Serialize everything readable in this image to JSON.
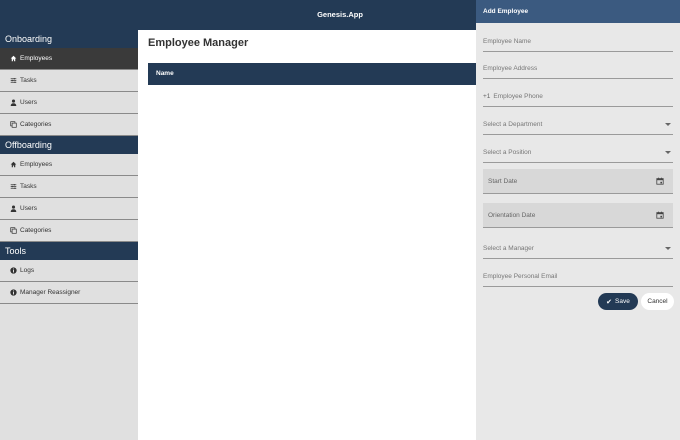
{
  "app": {
    "title": "Genesis.App"
  },
  "sidebar": {
    "sections": [
      {
        "title": "Onboarding",
        "items": [
          {
            "label": "Employees",
            "icon": "home-icon",
            "active": true
          },
          {
            "label": "Tasks",
            "icon": "sliders-icon"
          },
          {
            "label": "Users",
            "icon": "user-icon"
          },
          {
            "label": "Categories",
            "icon": "copy-icon"
          }
        ]
      },
      {
        "title": "Offboarding",
        "items": [
          {
            "label": "Employees",
            "icon": "home-icon"
          },
          {
            "label": "Tasks",
            "icon": "sliders-icon"
          },
          {
            "label": "Users",
            "icon": "user-icon"
          },
          {
            "label": "Categories",
            "icon": "copy-icon"
          }
        ]
      },
      {
        "title": "Tools",
        "items": [
          {
            "label": "Logs",
            "icon": "info-icon"
          },
          {
            "label": "Manager Reassigner",
            "icon": "info-icon"
          }
        ]
      }
    ]
  },
  "main": {
    "title": "Employee Manager",
    "table": {
      "columns": [
        "Name"
      ]
    }
  },
  "panel": {
    "title": "Add Employee",
    "fields": {
      "employee_name": "Employee Name",
      "employee_address": "Employee Address",
      "phone_prefix": "+1",
      "employee_phone": "Employee Phone",
      "department": "Select a Department",
      "position": "Select a Position",
      "start_date": "Start Date",
      "orientation_date": "Orientation Date",
      "manager": "Select a Manager",
      "personal_email": "Employee Personal Email"
    },
    "save_label": "Save",
    "cancel_label": "Cancel"
  },
  "colors": {
    "navy": "#233a55",
    "panel_header": "#3b5a80",
    "active_item": "#3a3a3a"
  }
}
